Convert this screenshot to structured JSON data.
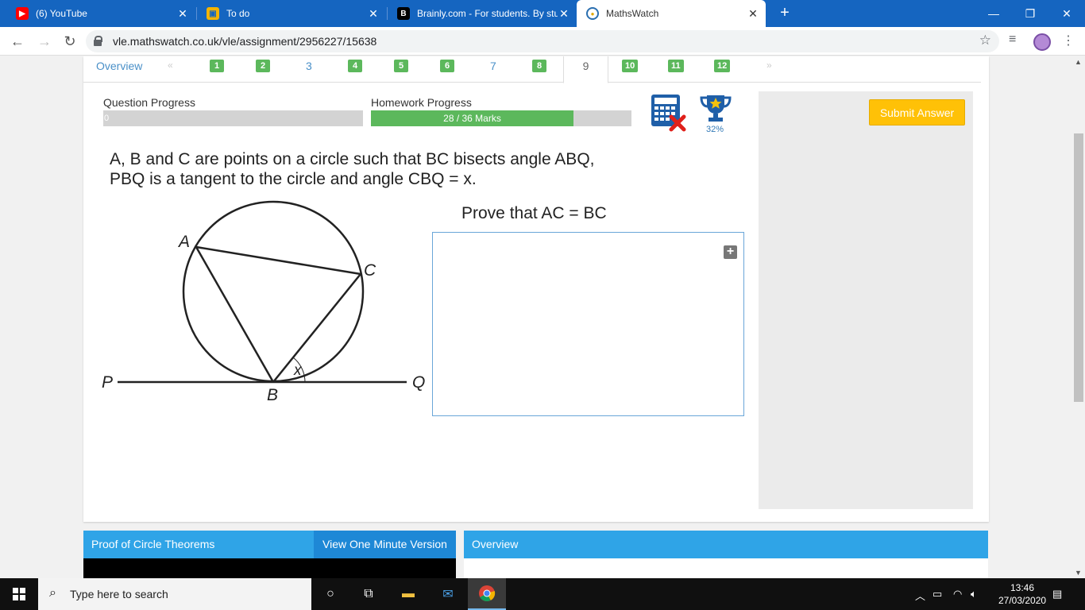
{
  "browser": {
    "tabs": [
      {
        "title": "(6) YouTube",
        "icon": "youtube-icon"
      },
      {
        "title": "To do",
        "icon": "todo-icon"
      },
      {
        "title": "Brainly.com - For students. By stu",
        "icon": "brainly-icon"
      },
      {
        "title": "MathsWatch",
        "icon": "mathswatch-icon",
        "active": true
      }
    ],
    "url": "vle.mathswatch.co.uk/vle/assignment/2956227/15638"
  },
  "qnav": {
    "overview": "Overview",
    "prev": "«",
    "next": "»",
    "items": [
      "1",
      "2",
      "3",
      "4",
      "5",
      "6",
      "7",
      "8",
      "9",
      "10",
      "11",
      "12"
    ],
    "current": "9"
  },
  "progress": {
    "question_label": "Question Progress",
    "question_value": "0",
    "question_fraction": 0,
    "homework_label": "Homework Progress",
    "homework_text": "28 / 36 Marks",
    "homework_fraction": 0.778,
    "trophy_pct": "32%"
  },
  "question": {
    "line1": "A, B and C are points on a circle such that BC bisects angle ABQ,",
    "line2": "PBQ is a tangent to the circle and angle CBQ = x.",
    "prove": "Prove that AC = BC"
  },
  "diagram": {
    "labels": {
      "A": "A",
      "B": "B",
      "C": "C",
      "P": "P",
      "Q": "Q",
      "x": "x"
    }
  },
  "sidebar": {
    "submit": "Submit Answer"
  },
  "panels": {
    "left_title": "Proof of Circle Theorems",
    "left_button": "View One Minute Version",
    "right_title": "Overview"
  },
  "taskbar": {
    "search_placeholder": "Type here to search",
    "time": "13:46",
    "date": "27/03/2020"
  },
  "colors": {
    "accent": "#2fa4e7",
    "badge": "#5cb85c",
    "submit": "#ffc107",
    "tabbar": "#1565c0"
  }
}
